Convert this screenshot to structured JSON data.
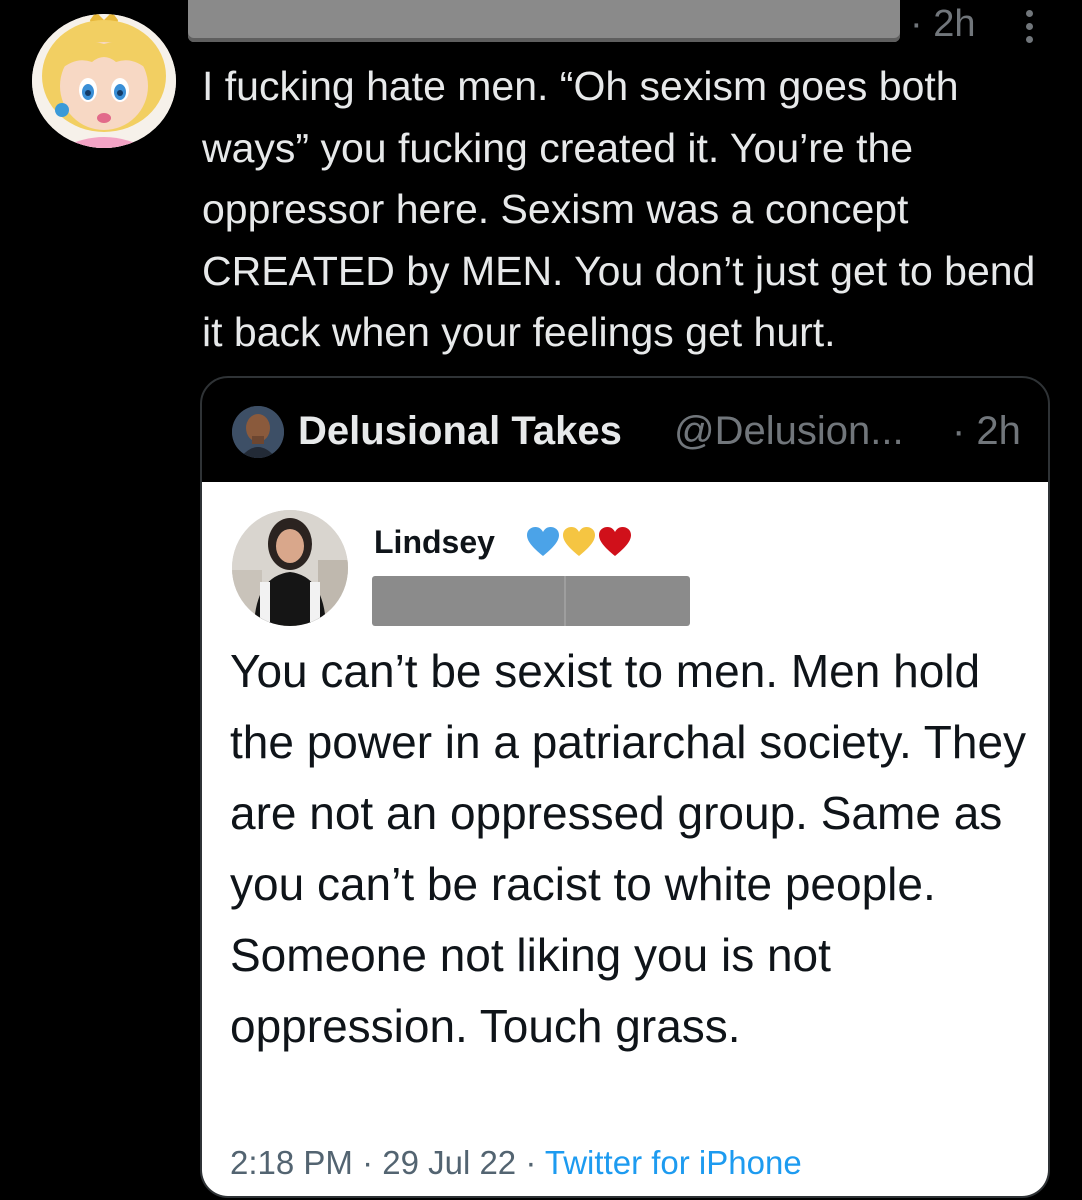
{
  "tweet": {
    "time": "· 2h",
    "text": "I fucking hate men. “Oh sexism goes both ways” you fucking created it. You’re the oppressor here. Sexism was a concept CREATED by MEN. You don’t just get to bend it back when your feelings get hurt.",
    "avatar_icon": "princess-avatar",
    "more_icon": "more-vertical-icon"
  },
  "quote": {
    "name": "Delusional Takes",
    "handle": "@Delusion...",
    "time": "· 2h",
    "avatar_icon": "profile-photo"
  },
  "embedded": {
    "name": "Lindsey",
    "hearts": [
      "#4ba3e8",
      "#f5c542",
      "#d0101a"
    ],
    "text": "You can’t be sexist to men. Men hold the power in a patriarchal society. They are not an oppressed group. Same as you can’t be racist to white people. Someone not liking you is not oppression. Touch grass.",
    "timestamp": "2:18 PM · 29 Jul 22 · ",
    "source": "Twitter for iPhone"
  },
  "colors": {
    "background": "#000000",
    "text_primary": "#e7e9ea",
    "text_secondary": "#71767b",
    "link": "#1d9bf0"
  }
}
